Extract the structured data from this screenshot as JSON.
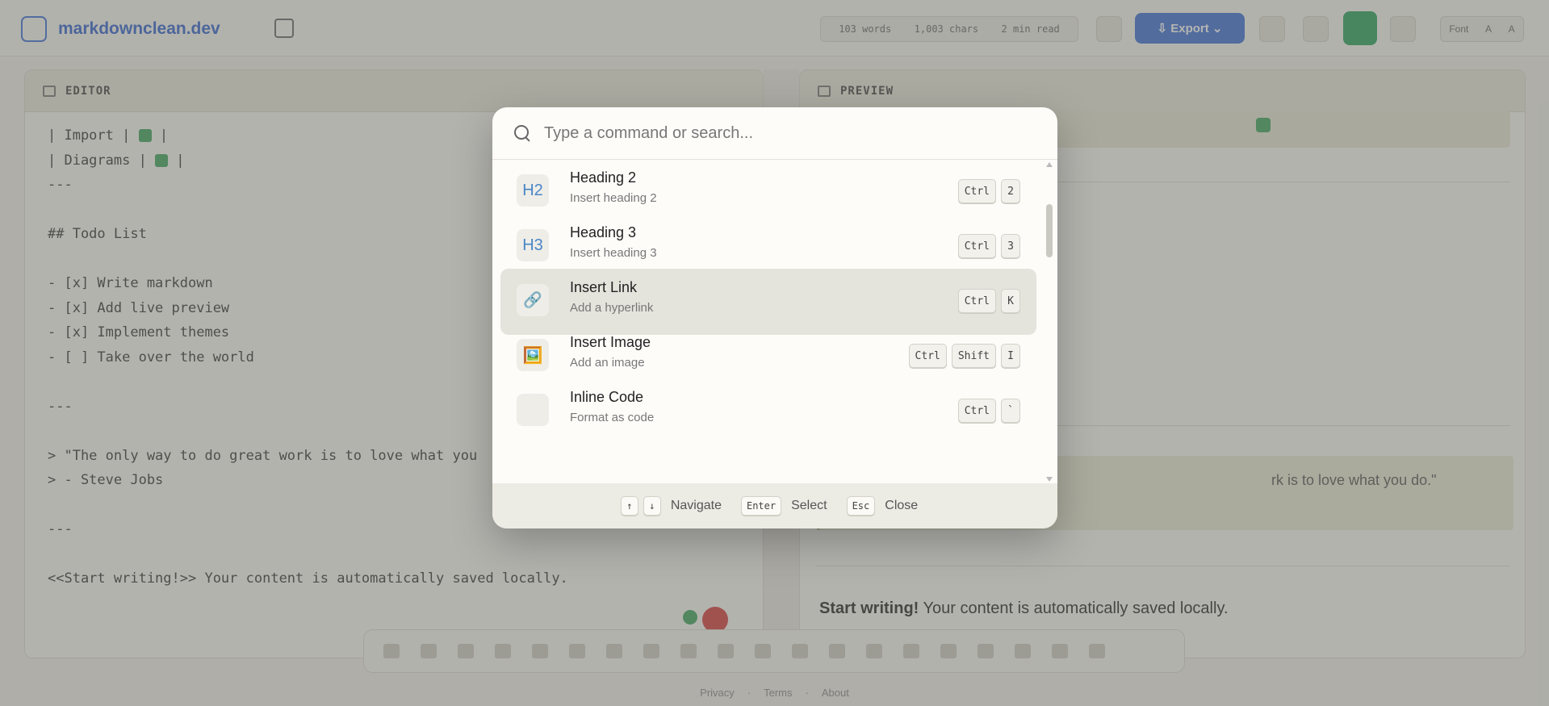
{
  "app": {
    "title": "markdownclean.dev",
    "stats": [
      "103 words",
      "1,003 chars",
      "2 min read"
    ],
    "export_label": "Export",
    "font_controls": [
      "Font",
      "A",
      "A"
    ]
  },
  "editor": {
    "header": "EDITOR",
    "lines": [
      "| Import | ",
      "| Diagrams | ",
      "---",
      "",
      "## Todo List",
      "",
      "- [x] Write markdown",
      "- [x] Add live preview",
      "- [x] Implement themes",
      "- [ ] Take over the world",
      "",
      "---",
      "",
      "> \"The only way to do great work is to love what you",
      "> - Steve Jobs",
      "",
      "---",
      "",
      "<<Start writing!>> Your content is automatically saved locally."
    ]
  },
  "preview": {
    "header": "PREVIEW",
    "quote": "rk is to love what you do.\"",
    "start_bold": "Start writing!",
    "start_rest": " Your content is automatically saved locally."
  },
  "footer": [
    "Privacy",
    "Terms",
    "About"
  ],
  "palette": {
    "search": {
      "placeholder": "Type a command or search...",
      "value": ""
    },
    "items": [
      {
        "icon": "H2",
        "icon_name": "heading-2-icon",
        "title": "Heading 2",
        "desc": "Insert heading 2",
        "keys": [
          "Ctrl",
          "2"
        ],
        "selected": false
      },
      {
        "icon": "H3",
        "icon_name": "heading-3-icon",
        "title": "Heading 3",
        "desc": "Insert heading 3",
        "keys": [
          "Ctrl",
          "3"
        ],
        "selected": false
      },
      {
        "icon": "🔗",
        "icon_name": "link-icon",
        "title": "Insert Link",
        "desc": "Add a hyperlink",
        "keys": [
          "Ctrl",
          "K"
        ],
        "selected": true
      },
      {
        "icon": "🖼️",
        "icon_name": "image-icon",
        "title": "Insert Image",
        "desc": "Add an image",
        "keys": [
          "Ctrl",
          "Shift",
          "I"
        ],
        "selected": false
      },
      {
        "icon": "",
        "icon_name": "code-icon",
        "title": "Inline Code",
        "desc": "Format as code",
        "keys": [
          "Ctrl",
          "`"
        ],
        "selected": false
      }
    ],
    "footer": {
      "navigate_keys": [
        "↑",
        "↓"
      ],
      "navigate_label": "Navigate",
      "select_key": "Enter",
      "select_label": "Select",
      "close_key": "Esc",
      "close_label": "Close"
    }
  },
  "colors": {
    "accent": "#3b6fd8",
    "heading_icon": "#4a86c8",
    "selected_row": "#e4e3dc",
    "overlay": "#696964"
  }
}
